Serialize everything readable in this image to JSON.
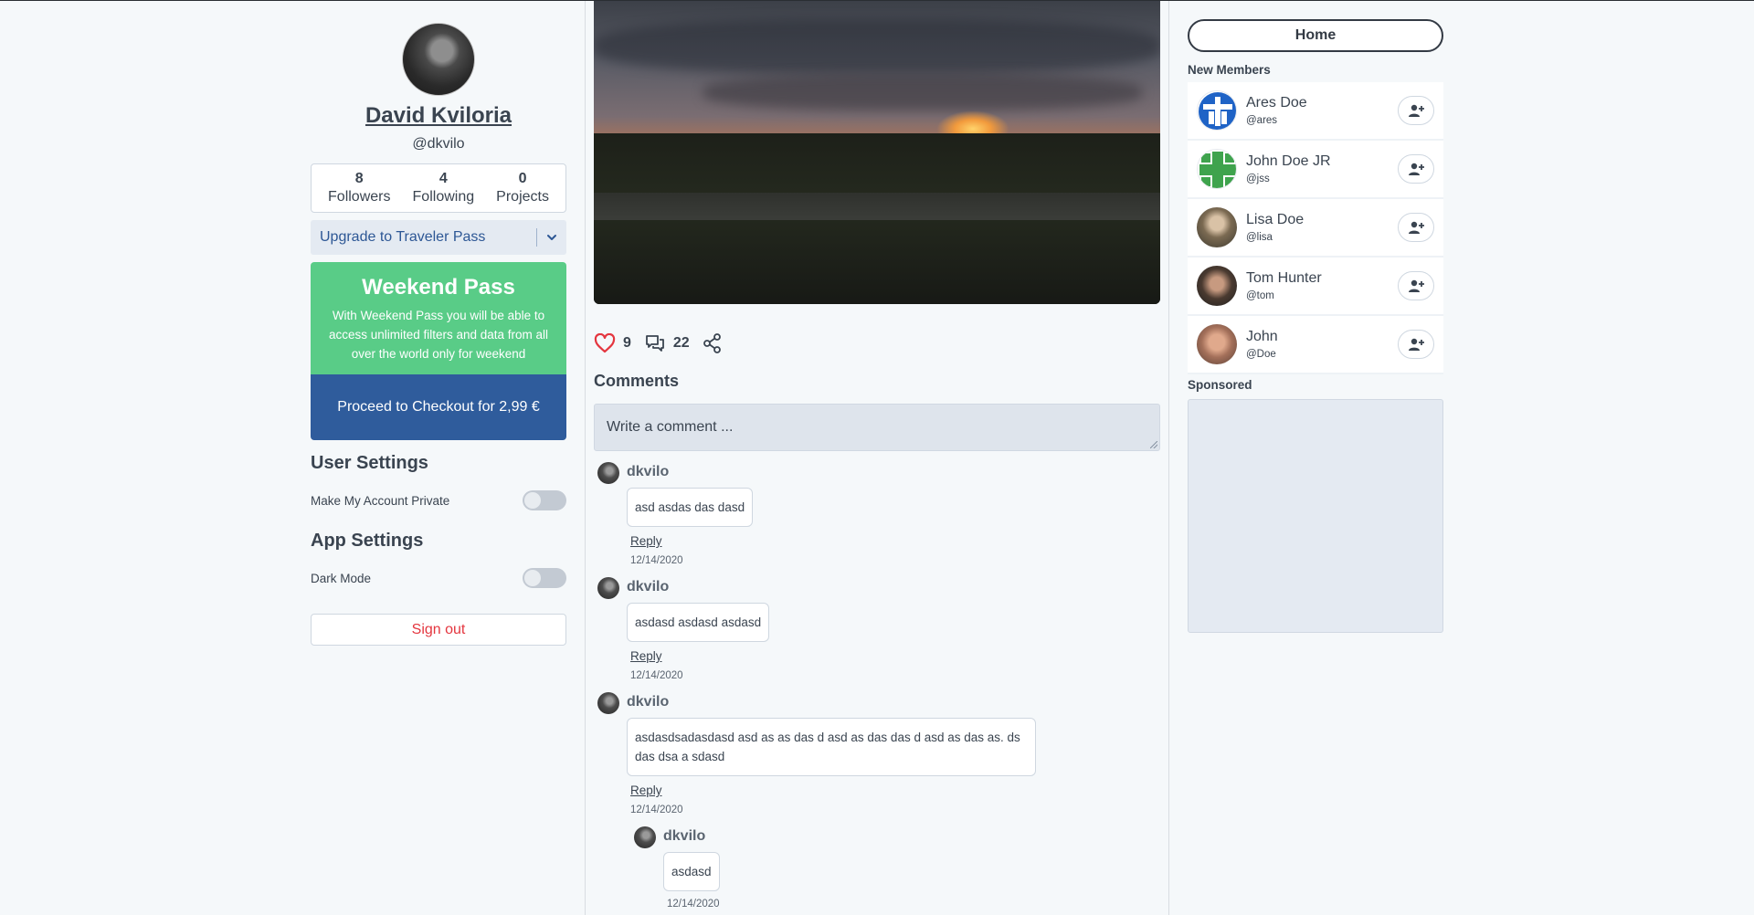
{
  "profile": {
    "name": "David Kviloria",
    "handle": "@dkvilo",
    "stats": [
      {
        "num": "8",
        "label": "Followers"
      },
      {
        "num": "4",
        "label": "Following"
      },
      {
        "num": "0",
        "label": "Projects"
      }
    ]
  },
  "upgrade": {
    "label": "Upgrade to Traveler Pass"
  },
  "pass": {
    "title": "Weekend Pass",
    "description": "With Weekend Pass you will be able to access unlimited filters and data from all over the world only for weekend",
    "checkout_label": "Proceed to Checkout for 2,99 €"
  },
  "user_settings": {
    "title": "User Settings",
    "private_label": "Make My Account Private",
    "private_enabled": false
  },
  "app_settings": {
    "title": "App Settings",
    "dark_mode_label": "Dark Mode",
    "dark_mode_enabled": false
  },
  "signout_label": "Sign out",
  "post": {
    "likes": "9",
    "comments_count": "22"
  },
  "comments_section": {
    "title": "Comments",
    "placeholder": "Write a comment ...",
    "reply_label": "Reply",
    "items": [
      {
        "user": "dkvilo",
        "text": "asd asdas das dasd",
        "date": "12/14/2020"
      },
      {
        "user": "dkvilo",
        "text": "asdasd asdasd asdasd",
        "date": "12/14/2020"
      },
      {
        "user": "dkvilo",
        "text": "asdasdsadasdasd asd as as das d asd as das das d asd as das as. ds das dsa a sdasd",
        "date": "12/14/2020"
      }
    ],
    "nested_reply": {
      "user": "dkvilo",
      "text": "asdasd",
      "date": "12/14/2020"
    }
  },
  "nav": {
    "home_label": "Home"
  },
  "new_members": {
    "title": "New Members",
    "items": [
      {
        "name": "Ares Doe",
        "handle": "@ares",
        "avatar": "blue-cross-icon"
      },
      {
        "name": "John Doe JR",
        "handle": "@jss",
        "avatar": "green-cross-icon"
      },
      {
        "name": "Lisa Doe",
        "handle": "@lisa",
        "avatar": "photo"
      },
      {
        "name": "Tom Hunter",
        "handle": "@tom",
        "avatar": "photo"
      },
      {
        "name": "John",
        "handle": "@Doe",
        "avatar": "photo"
      }
    ]
  },
  "sponsored": {
    "title": "Sponsored"
  },
  "colors": {
    "accent_blue": "#2f5c9c",
    "pass_green": "#59cc87",
    "signout_red": "#e4363f",
    "like_red": "#e4363f"
  }
}
